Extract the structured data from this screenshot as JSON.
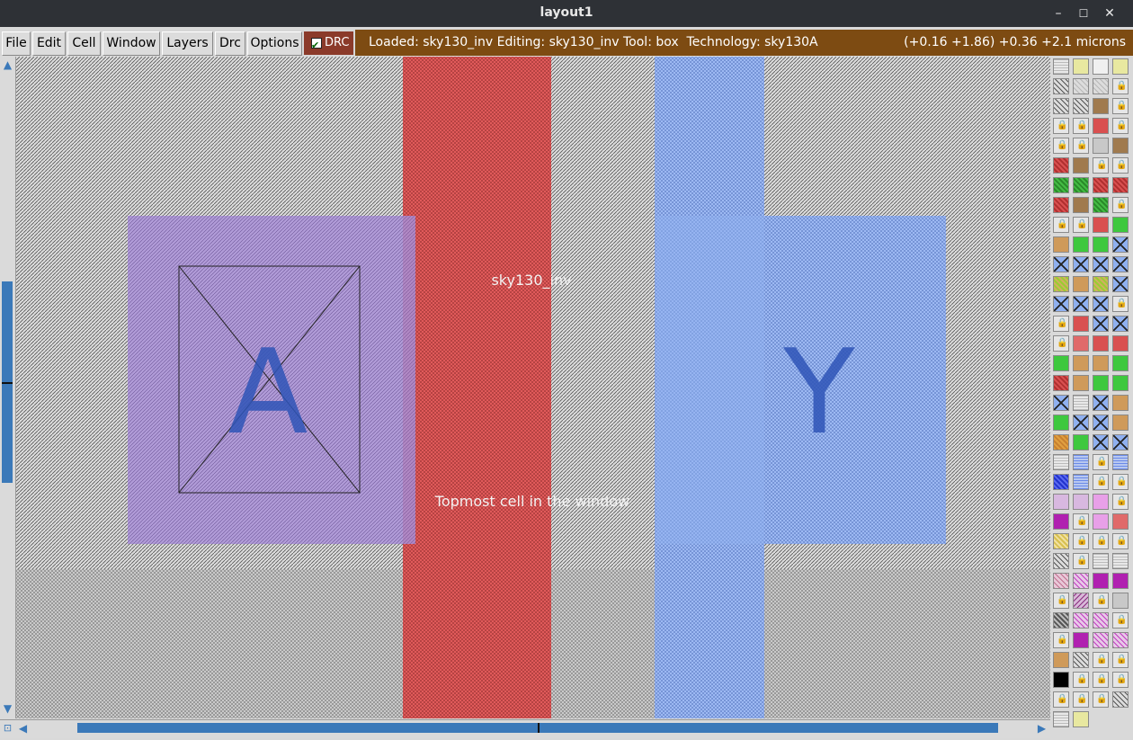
{
  "window": {
    "title": "layout1",
    "minimize": "–",
    "maximize": "☐",
    "close": "✕"
  },
  "menus": [
    "File",
    "Edit",
    "Cell",
    "Window",
    "Layers",
    "Drc",
    "Options"
  ],
  "drc": {
    "label": "DRC",
    "checked": true
  },
  "status": {
    "text": "Loaded: sky130_inv Editing: sky130_inv Tool: box  Technology: sky130A",
    "coords": "(+0.16 +1.86) +0.36 +2.1 microns"
  },
  "layout": {
    "cell_name": "sky130_inv",
    "topmost_note": "Topmost cell in the window",
    "port_a": "A",
    "port_y": "Y"
  },
  "colors": {
    "titlebar": "#2e3136",
    "status": "#7d4b12",
    "drc": "#8b3a2a",
    "poly": "#e05a5a",
    "metal1": "#8fb0f0",
    "accent_blue": "#3b79b9"
  },
  "icons": {
    "scroll_up": "scroll-up-arrow-icon",
    "scroll_down": "scroll-down-arrow-icon",
    "scroll_left": "scroll-left-arrow-icon",
    "scroll_right": "scroll-right-arrow-icon",
    "zoom_box": "zoom-box-icon",
    "lock": "lock-icon"
  },
  "palette": {
    "columns": 4,
    "swatches": [
      "gx",
      "gy",
      "gw",
      "gy",
      "hat",
      "gd",
      "gd",
      "L",
      "hat",
      "hat",
      "br",
      "L",
      "L",
      "L",
      "r",
      "L",
      "L",
      "L",
      "gry",
      "br",
      "rd",
      "br",
      "L",
      "L",
      "gr",
      "gr",
      "rd",
      "rd",
      "rd",
      "br",
      "gr",
      "L",
      "L",
      "L",
      "r",
      "g",
      "tn",
      "g",
      "g",
      "bx",
      "bx",
      "bx",
      "bx",
      "bx",
      "gt",
      "tn",
      "gt",
      "bx",
      "bx",
      "bx",
      "bx",
      "L",
      "L",
      "r",
      "bx",
      "bx",
      "L",
      "pk",
      "r",
      "r",
      "g",
      "tn",
      "tn",
      "g",
      "rd",
      "tn",
      "g",
      "g",
      "bx",
      "gx",
      "bx",
      "tn",
      "g",
      "bx",
      "bx",
      "tn",
      "or",
      "g",
      "bx",
      "bx",
      "gx",
      "bl",
      "L",
      "bl",
      "bp",
      "bl",
      "L",
      "L",
      "lp",
      "lp",
      "pv",
      "L",
      "mg",
      "L",
      "pv",
      "pk",
      "yt",
      "L",
      "L",
      "L",
      "hat",
      "L",
      "gx",
      "gx",
      "pkh",
      "mgh",
      "mg",
      "mg",
      "L",
      "mgd",
      "L",
      "gry",
      "dk",
      "mgh",
      "mgh",
      "L",
      "L",
      "mg",
      "mgh",
      "mgh",
      "tn",
      "hat",
      "L",
      "L",
      "blk",
      "L",
      "L",
      "L",
      "L",
      "L",
      "L",
      "hat",
      "gx",
      "gy"
    ]
  }
}
